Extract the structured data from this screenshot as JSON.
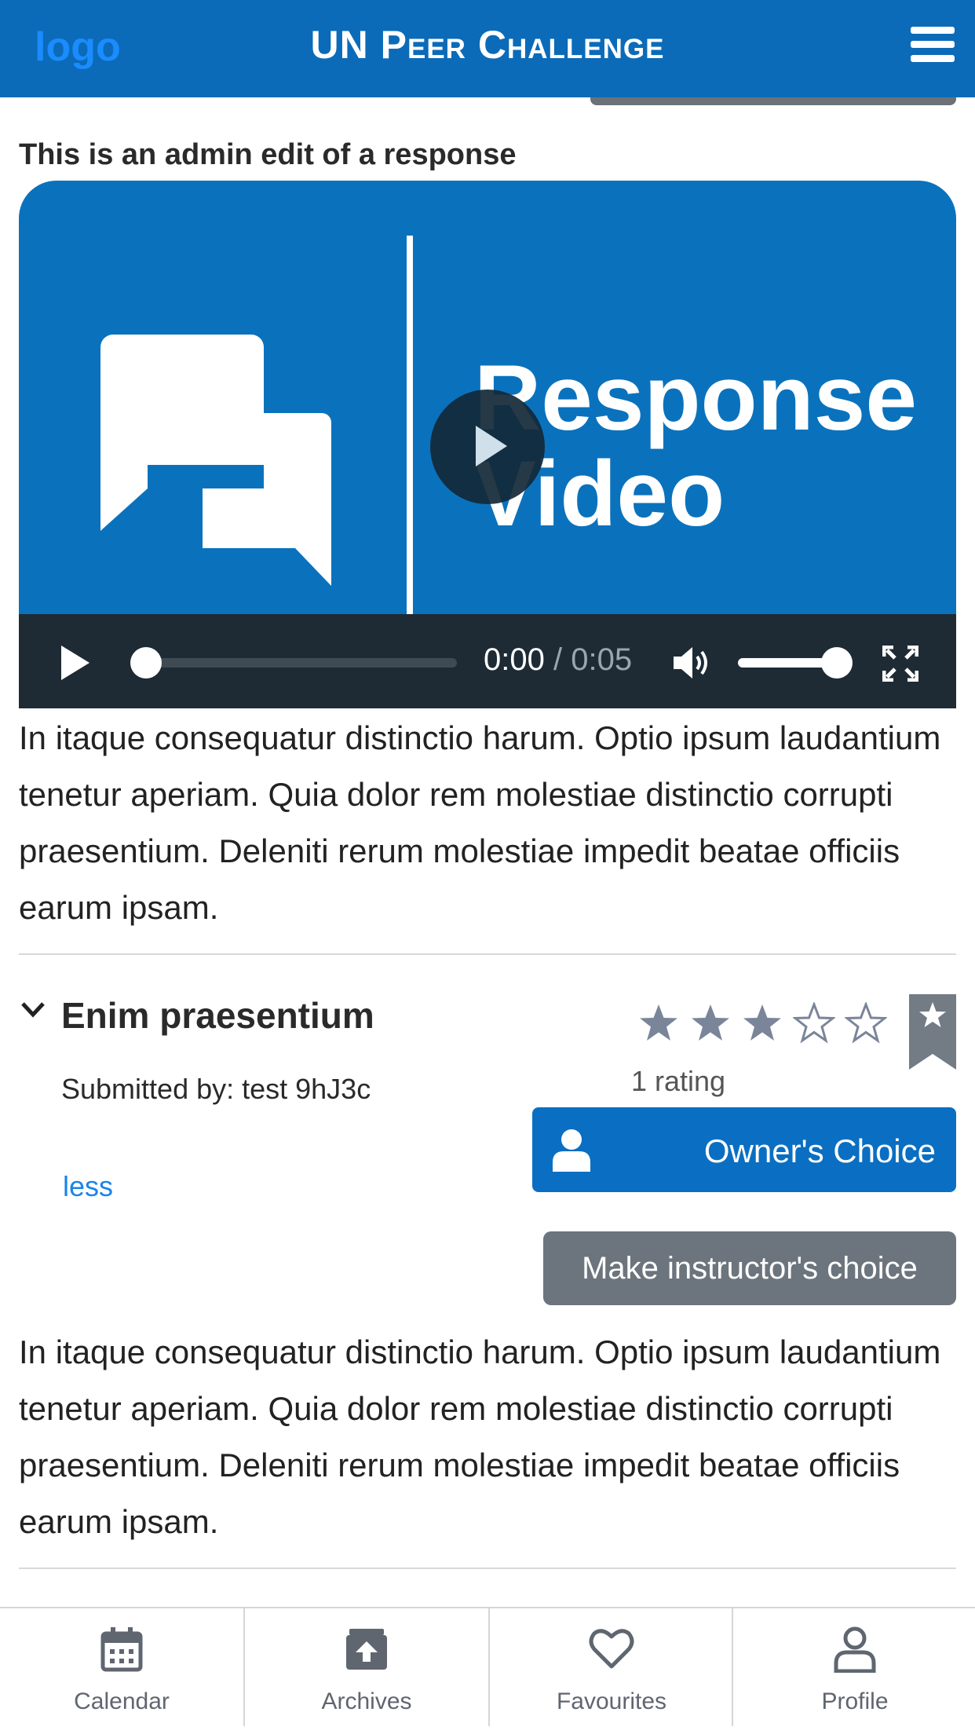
{
  "header": {
    "logo": "logo",
    "title": "UN Peer Challenge",
    "menu_icon": "hamburger-menu-icon"
  },
  "section": {
    "heading": "This is an admin edit of a response"
  },
  "video": {
    "poster_line1": "Response",
    "poster_line2": "Video",
    "current_time": "0:00",
    "separator": "/",
    "duration": "0:05",
    "progress": 0,
    "volume": 1.0
  },
  "paragraphs": {
    "top": "In itaque consequatur distinctio harum. Optio ipsum laudantium tenetur aperiam. Quia dolor rem molestiae distinctio corrupti praesentium. Deleniti rerum molestiae impedit beatae officiis earum ipsam.",
    "bottom": "In itaque consequatur distinctio harum. Optio ipsum laudantium tenetur aperiam. Quia dolor rem molestiae distinctio corrupti praesentium. Deleniti rerum molestiae impedit beatae officiis earum ipsam."
  },
  "response": {
    "title": "Enim praesentium",
    "submitted_by": "Submitted by: test 9hJ3c",
    "less_link": "less",
    "rating": 3,
    "rating_max": 5,
    "rating_count": "1 rating",
    "owners_choice_label": "Owner's Choice",
    "instructor_button": "Make instructor's choice"
  },
  "colors": {
    "brand": "#0b6bb8",
    "star_fill": "#7a8599",
    "button_grey": "#6c757d"
  },
  "tabbar": {
    "tabs": [
      {
        "label": "Calendar",
        "icon": "calendar-icon"
      },
      {
        "label": "Archives",
        "icon": "archive-icon"
      },
      {
        "label": "Favourites",
        "icon": "heart-icon"
      },
      {
        "label": "Profile",
        "icon": "user-icon"
      }
    ]
  }
}
